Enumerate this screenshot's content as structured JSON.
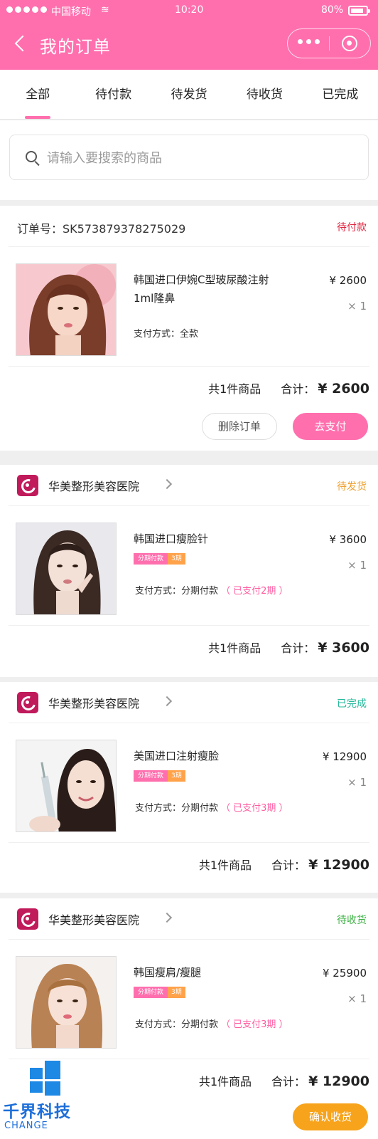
{
  "status_bar": {
    "carrier": "中国移动",
    "time": "10:20",
    "battery": "80%"
  },
  "nav": {
    "title": "我的订单"
  },
  "tabs": [
    {
      "label": "全部",
      "active": true
    },
    {
      "label": "待付款",
      "active": false
    },
    {
      "label": "待发货",
      "active": false
    },
    {
      "label": "待收货",
      "active": false
    },
    {
      "label": "已完成",
      "active": false
    }
  ],
  "search": {
    "placeholder": "请输入要搜索的商品"
  },
  "colors": {
    "brand": "#ff6fae",
    "status_pending_pay": "#e0233f",
    "status_pending_ship": "#f0a030",
    "status_done": "#23b89a",
    "status_pending_receive": "#3cb043"
  },
  "orders": [
    {
      "header": "订单号：SK573879378275029",
      "status": "待付款",
      "product_name": "韩国进口伊婉C型玻尿酸注射1ml隆鼻",
      "price": "¥ 2600",
      "qty": "× 1",
      "pay_method": "支付方式：全款",
      "count": "共1件商品",
      "total_label": "合计：",
      "total": "¥ 2600",
      "buttons": [
        "删除订单",
        "去支付"
      ]
    },
    {
      "header": "华美整形美容医院",
      "status": "待发货",
      "product_name": "韩国进口瘦脸针",
      "tag": [
        "分期付款",
        "3期"
      ],
      "price": "¥ 3600",
      "qty": "× 1",
      "pay_method": "支付方式：分期付款",
      "pay_progress": "（ 已支付2期 ）",
      "count": "共1件商品",
      "total_label": "合计：",
      "total": "¥ 3600"
    },
    {
      "header": "华美整形美容医院",
      "status": "已完成",
      "product_name": "美国进口注射瘦脸",
      "tag": [
        "分期付款",
        "3期"
      ],
      "price": "¥ 12900",
      "qty": "× 1",
      "pay_method": "支付方式：分期付款",
      "pay_progress": "（ 已支付3期 ）",
      "count": "共1件商品",
      "total_label": "合计：",
      "total": "¥ 12900"
    },
    {
      "header": "华美整形美容医院",
      "status": "待收货",
      "product_name": "韩国瘦肩/瘦腿",
      "tag": [
        "分期付款",
        "3期"
      ],
      "price": "¥ 25900",
      "qty": "× 1",
      "pay_method": "支付方式：分期付款",
      "pay_progress": "（ 已支付3期 ）",
      "count": "共1件商品",
      "total_label": "合计：",
      "total": "¥ 12900",
      "buttons": [
        "确认收货"
      ]
    }
  ],
  "watermark": {
    "name": "千界科技",
    "sub": "CHANGE"
  }
}
